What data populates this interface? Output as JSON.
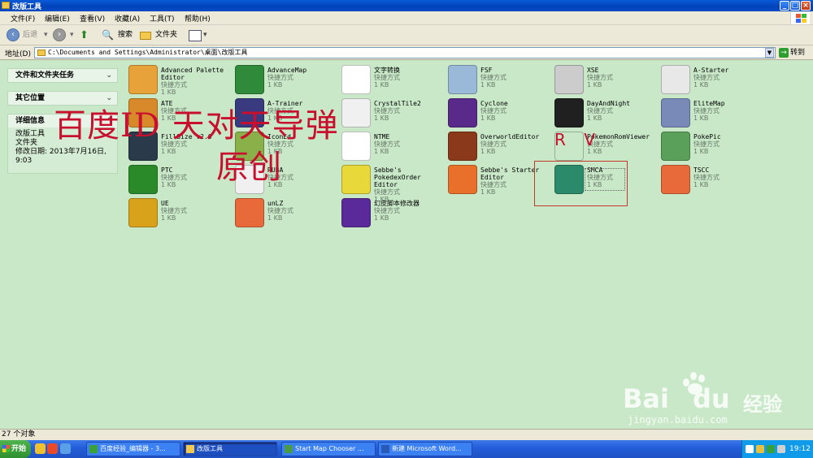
{
  "window": {
    "title": "改版工具"
  },
  "menu": [
    "文件(F)",
    "编辑(E)",
    "查看(V)",
    "收藏(A)",
    "工具(T)",
    "帮助(H)"
  ],
  "toolbar": {
    "back": "后退",
    "search": "搜索",
    "folders": "文件夹"
  },
  "address": {
    "label": "地址(D)",
    "path": "C:\\Documents and Settings\\Administrator\\桌面\\改版工具",
    "go": "转到"
  },
  "sidebar": {
    "tasks": "文件和文件夹任务",
    "other": "其它位置",
    "details": {
      "title": "详细信息",
      "name": "改版工具",
      "type": "文件夹",
      "modified": "修改日期: 2013年7月16日, 9:03"
    }
  },
  "shortcut_label": "快捷方式",
  "size_label": "1 KB",
  "files": [
    {
      "name": "Advanced Palette Editor",
      "icon": "palette-icon",
      "color": "#e7a33a"
    },
    {
      "name": "AdvanceMap",
      "icon": "advancemap-icon",
      "color": "#2f8a3a"
    },
    {
      "name": "文字转换",
      "icon": "text-convert-icon",
      "color": "#ffffff"
    },
    {
      "name": "FSF",
      "icon": "magnifier-icon",
      "color": "#9ab8d8"
    },
    {
      "name": "XSE",
      "icon": "gears-icon",
      "color": "#cccccc"
    },
    {
      "name": "A-Starter",
      "icon": "puzzle-icon",
      "color": "#e8e8e8"
    },
    {
      "name": "ATE",
      "icon": "palette-icon",
      "color": "#d88a2a"
    },
    {
      "name": "A-Trainer",
      "icon": "vs-icon",
      "color": "#3a3a80"
    },
    {
      "name": "CrystalTile2",
      "icon": "crystal-icon",
      "color": "#f0f0f0"
    },
    {
      "name": "Cyclone",
      "icon": "cyclone-icon",
      "color": "#5a2a8a"
    },
    {
      "name": "DayAndNight",
      "icon": "dn-icon",
      "color": "#202020"
    },
    {
      "name": "EliteMap",
      "icon": "elitemap-icon",
      "color": "#7a8ab8"
    },
    {
      "name": "FillSize v2.0",
      "icon": "fillsize-icon",
      "color": "#2a3a4a"
    },
    {
      "name": "IconEd",
      "icon": "iconed-icon",
      "color": "#8ab04a"
    },
    {
      "name": "NTME",
      "icon": "ntme-icon",
      "color": "#ffffff"
    },
    {
      "name": "OverworldEditor",
      "icon": "overworld-icon",
      "color": "#8a3a1a"
    },
    {
      "name": "PokemonRomViewer",
      "icon": "rv-icon",
      "color": "#c8e8c8"
    },
    {
      "name": "PokePic",
      "icon": "pokepic-icon",
      "color": "#5aa05a"
    },
    {
      "name": "PTC",
      "icon": "ptc-icon",
      "color": "#2a8a2a"
    },
    {
      "name": "RUBA",
      "icon": "ruba-icon",
      "color": "#f0f0f0"
    },
    {
      "name": "Sebbe's PokedexOrder Editor",
      "icon": "pokedex-icon",
      "color": "#e8d83a"
    },
    {
      "name": "Sebbe's Starter Editor",
      "icon": "starter-icon",
      "color": "#e8702a"
    },
    {
      "name": "SMCA",
      "icon": "smca-icon",
      "color": "#2a8a6a"
    },
    {
      "name": "TSCC",
      "icon": "tscc-icon",
      "color": "#e86a3a"
    },
    {
      "name": "UE",
      "icon": "ue-icon",
      "color": "#d8a21a"
    },
    {
      "name": "unLZ",
      "icon": "unlz-icon",
      "color": "#e86a3a"
    },
    {
      "name": "幻皮脚本修改器",
      "icon": "script-editor-icon",
      "color": "#5a2a9a"
    }
  ],
  "watermark": {
    "line1": "百度ID   天对天导弹",
    "line2": "原创",
    "rv": "R V"
  },
  "status": {
    "count": "27 个对象"
  },
  "taskbar": {
    "start": "开始",
    "buttons": [
      "百度经验_编辑器 - 3...",
      "改版工具",
      "Start Map Chooser ...",
      "新建 Microsoft Word..."
    ],
    "clock": "19:12"
  },
  "baidu_watermark": {
    "brand": "Bai",
    "du": "du",
    "jingyan": "经验",
    "url": "jingyan.baidu.com"
  }
}
